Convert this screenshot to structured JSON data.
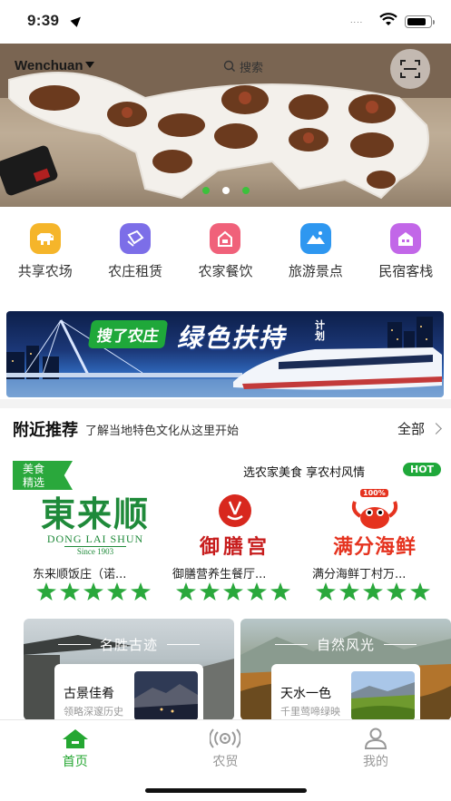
{
  "status": {
    "time": "9:39",
    "signal": "....",
    "battery_level": 0.85
  },
  "banner": {
    "location": "Wenchuan",
    "search_placeholder": "搜索",
    "dots": [
      {
        "active": false
      },
      {
        "active": true
      },
      {
        "active": false
      }
    ]
  },
  "categories": [
    {
      "label": "共享农场",
      "color": "#f5b52a",
      "icon": "cow-icon"
    },
    {
      "label": "农庄租赁",
      "color": "#7c6ee8",
      "icon": "contract-icon"
    },
    {
      "label": "农家餐饮",
      "color": "#f0617a",
      "icon": "food-icon"
    },
    {
      "label": "旅游景点",
      "color": "#2e97f0",
      "icon": "mountain-icon"
    },
    {
      "label": "民宿客栈",
      "color": "#c267e8",
      "icon": "house-icon"
    }
  ],
  "promo": {
    "tag": "搜了农庄",
    "title": "绿色扶持",
    "subtitle": "计划"
  },
  "nearby": {
    "title": "附近推荐",
    "subtitle": "了解当地特色文化从这里开始",
    "all_label": "全部"
  },
  "food": {
    "badge_line1": "美食",
    "badge_line2": "精选",
    "slogan": "选农家美食 享农村风情",
    "hot": "HOT",
    "shops": [
      {
        "name": "东来顺饭庄（诺...",
        "logo_main": "東来顺",
        "logo_sub": "DONG LAI SHUN",
        "logo_since": "Since 1903",
        "rating": 5
      },
      {
        "name": "御膳营养生餐厅...",
        "logo_main": "御膳宫",
        "rating": 5
      },
      {
        "name": "满分海鲜丁村万...",
        "logo_main": "满分海鲜",
        "logo_badge": "100%",
        "rating": 5
      }
    ]
  },
  "scenic": [
    {
      "title": "名胜古迹",
      "card_title": "古景佳肴",
      "card_sub": "领略深邃历史"
    },
    {
      "title": "自然风光",
      "card_title": "天水一色",
      "card_sub": "千里莺啼绿映"
    }
  ],
  "tabs": [
    {
      "label": "首页",
      "active": true
    },
    {
      "label": "农贸",
      "active": false
    },
    {
      "label": "我的",
      "active": false
    }
  ],
  "colors": {
    "accent": "#25a732",
    "hot": "#1fa83a"
  }
}
